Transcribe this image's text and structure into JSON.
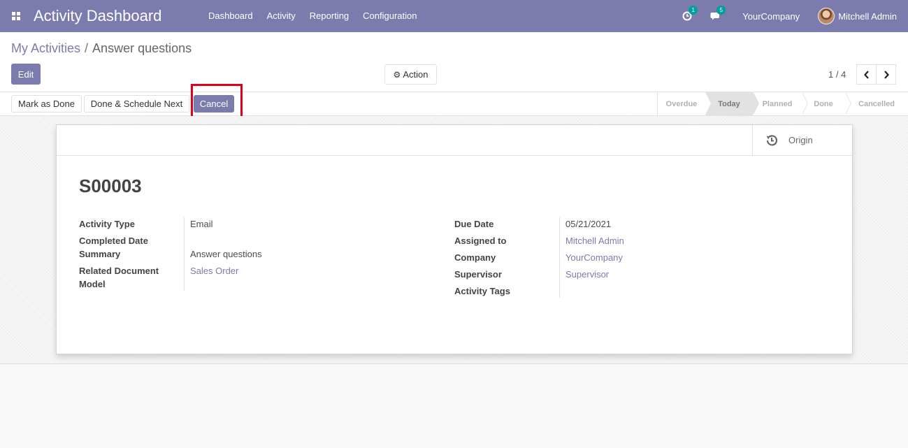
{
  "navbar": {
    "app_title": "Activity Dashboard",
    "menu": [
      "Dashboard",
      "Activity",
      "Reporting",
      "Configuration"
    ],
    "activity_count": "1",
    "message_count": "5",
    "company": "YourCompany",
    "user": "Mitchell Admin"
  },
  "breadcrumb": {
    "parent": "My Activities",
    "separator": "/",
    "current": "Answer questions"
  },
  "buttons": {
    "edit": "Edit",
    "action": "Action"
  },
  "pager": {
    "value": "1 / 4"
  },
  "statusbar": {
    "mark_done": "Mark as Done",
    "done_schedule": "Done & Schedule Next",
    "cancel": "Cancel",
    "stages": [
      "Overdue",
      "Today",
      "Planned",
      "Done",
      "Cancelled"
    ],
    "active_stage": "Today"
  },
  "smart_button": {
    "label": "Origin",
    "icon": "history-icon"
  },
  "record": {
    "title": "S00003",
    "left_fields": [
      {
        "label": "Activity Type",
        "value": "Email"
      },
      {
        "label": "Completed Date",
        "value": ""
      },
      {
        "label": "Summary",
        "value": "Answer questions"
      },
      {
        "label": "Related Document Model",
        "value": "Sales Order"
      }
    ],
    "right_fields": [
      {
        "label": "Due Date",
        "value": "05/21/2021"
      },
      {
        "label": "Assigned to",
        "value": "Mitchell Admin"
      },
      {
        "label": "Company",
        "value": "YourCompany"
      },
      {
        "label": "Supervisor",
        "value": "Supervisor"
      },
      {
        "label": "Activity Tags",
        "value": ""
      }
    ]
  },
  "colors": {
    "brand": "#7c7bad",
    "badge": "#00a09d",
    "highlight": "#e0001a"
  }
}
